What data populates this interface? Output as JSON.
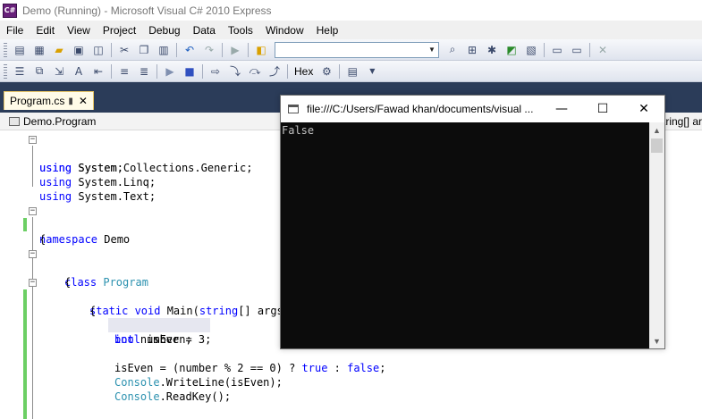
{
  "window": {
    "title": "Demo (Running) - Microsoft Visual C# 2010 Express",
    "icon_label": "C#"
  },
  "menu": [
    "File",
    "Edit",
    "View",
    "Project",
    "Debug",
    "Data",
    "Tools",
    "Window",
    "Help"
  ],
  "toolbar": {
    "hex_label": "Hex",
    "solution_config_value": ""
  },
  "tabs": [
    {
      "label": "Program.cs",
      "active": true
    }
  ],
  "navigation": {
    "type_dropdown": "Demo.Program",
    "member_dropdown_partial": "tring[] ar"
  },
  "code_lines": [
    {
      "prefix": "",
      "kw": "using",
      "rest": " System;"
    },
    {
      "prefix": "",
      "kw": "using",
      "rest": " System.Collections.Generic;"
    },
    {
      "prefix": "",
      "kw": "using",
      "rest": " System.Linq;"
    },
    {
      "prefix": "",
      "kw": "using",
      "rest": " System.Text;"
    },
    {
      "prefix": "",
      "kw": "",
      "rest": ""
    },
    {
      "prefix": "",
      "kw": "namespace",
      "rest": " Demo"
    },
    {
      "prefix": "",
      "kw": "",
      "rest": "{"
    },
    {
      "prefix": "",
      "kw": "",
      "rest": ""
    },
    {
      "prefix": "    ",
      "kw": "class",
      "type": " Program",
      "rest": ""
    },
    {
      "prefix": "    ",
      "kw": "",
      "rest": "{"
    },
    {
      "prefix": "        ",
      "kw": "static void",
      "rest": " Main(",
      "kw2": "string",
      "rest2": "[] args)"
    },
    {
      "prefix": "        ",
      "kw": "",
      "rest": "{"
    },
    {
      "prefix": "            ",
      "kw": "int",
      "rest": " number = 3;"
    },
    {
      "prefix": "            ",
      "kw": "bool",
      "rest": " isEven;"
    },
    {
      "prefix": "",
      "kw": "",
      "rest": ""
    },
    {
      "prefix": "            ",
      "kw": "",
      "rest": "isEven = (number % 2 == 0) ? ",
      "kw2": "true",
      "rest2": " : ",
      "kw3": "false",
      "rest3": ";"
    },
    {
      "prefix": "            ",
      "kw": "",
      "type": "Console",
      "rest": ".WriteLine(isEven);"
    },
    {
      "prefix": "            ",
      "kw": "",
      "type": "Console",
      "rest": ".ReadKey();"
    },
    {
      "prefix": "",
      "kw": "",
      "rest": ""
    },
    {
      "prefix": "        ",
      "kw": "",
      "rest": "}"
    }
  ],
  "console": {
    "title": "file:///C:/Users/Fawad khan/documents/visual ...",
    "output": "False",
    "minimize_glyph": "—",
    "maximize_glyph": "☐",
    "close_glyph": "✕"
  },
  "colors": {
    "keyword": "#0000ff",
    "type": "#2b91af",
    "tab_strip": "#2b3c59",
    "console_bg": "#0c0c0c",
    "console_text": "#c0c0c0",
    "change_bar": "#6ccf64"
  }
}
